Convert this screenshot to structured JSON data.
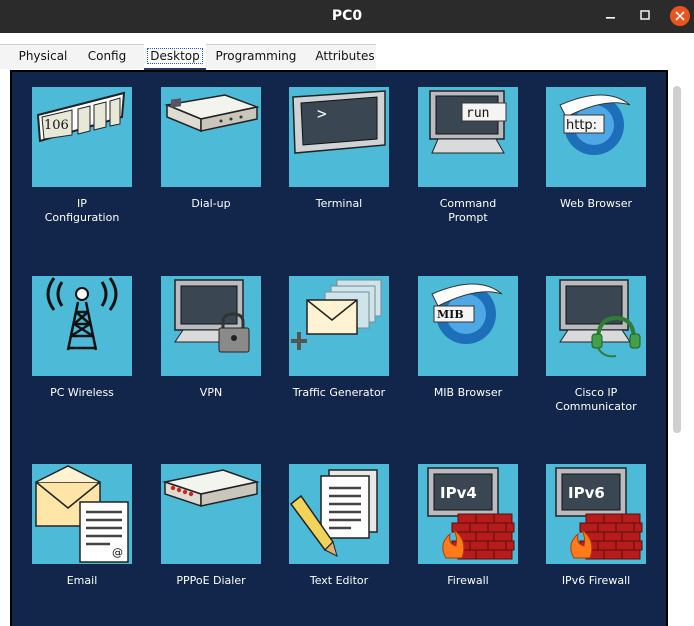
{
  "window": {
    "title": "PC0",
    "min_icon": "minimize-icon",
    "max_icon": "maximize-icon",
    "close_icon": "close-icon"
  },
  "tabs": [
    {
      "label": "Physical",
      "active": false
    },
    {
      "label": "Config",
      "active": false
    },
    {
      "label": "Desktop",
      "active": true
    },
    {
      "label": "Programming",
      "active": false
    },
    {
      "label": "Attributes",
      "active": false
    }
  ],
  "apps": [
    {
      "label": "IP\nConfiguration",
      "icon": "ip-configuration-icon",
      "icon_text": "106"
    },
    {
      "label": "Dial-up",
      "icon": "modem-icon"
    },
    {
      "label": "Terminal",
      "icon": "terminal-icon",
      "icon_text": ">"
    },
    {
      "label": "Command\nPrompt",
      "icon": "command-prompt-icon",
      "icon_text": "run"
    },
    {
      "label": "Web Browser",
      "icon": "web-browser-icon",
      "icon_text": "http:"
    },
    {
      "label": "PC Wireless",
      "icon": "wireless-tower-icon"
    },
    {
      "label": "VPN",
      "icon": "vpn-lock-icon"
    },
    {
      "label": "Traffic Generator",
      "icon": "traffic-generator-icon"
    },
    {
      "label": "MIB Browser",
      "icon": "mib-browser-icon",
      "icon_text": "MIB"
    },
    {
      "label": "Cisco IP\nCommunicator",
      "icon": "headset-monitor-icon"
    },
    {
      "label": "Email",
      "icon": "email-icon",
      "icon_text": "@"
    },
    {
      "label": "PPPoE Dialer",
      "icon": "pppoe-dialer-icon"
    },
    {
      "label": "Text Editor",
      "icon": "text-editor-icon"
    },
    {
      "label": "Firewall",
      "icon": "firewall-icon",
      "icon_text": "IPv4"
    },
    {
      "label": "IPv6 Firewall",
      "icon": "ipv6-firewall-icon",
      "icon_text": "IPv6"
    }
  ]
}
